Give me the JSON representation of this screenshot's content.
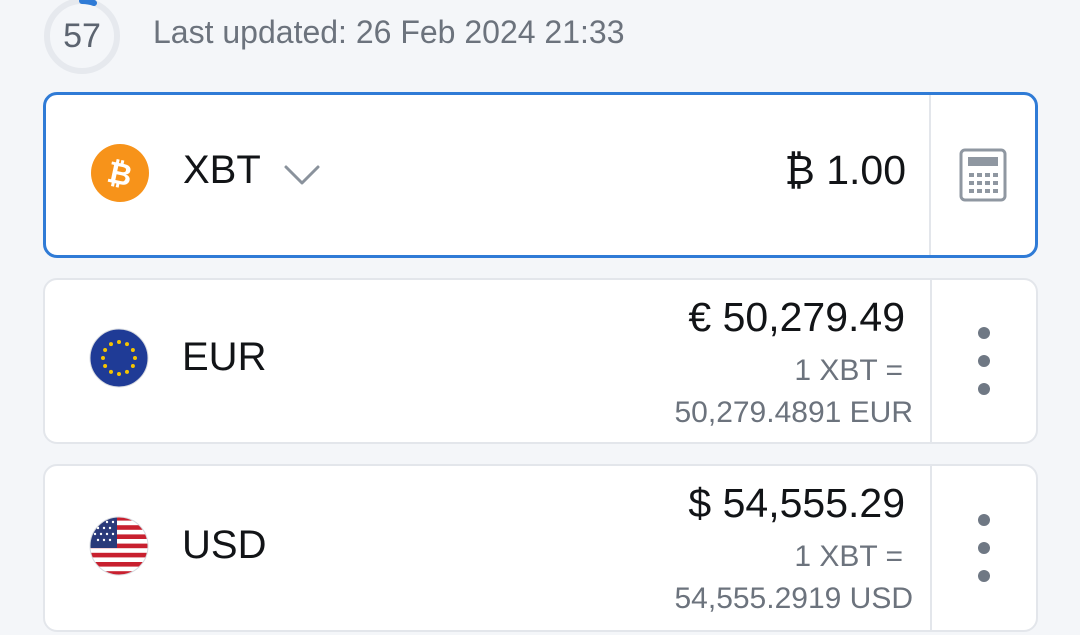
{
  "header": {
    "countdown": "57",
    "last_updated": "Last updated: 26 Feb 2024 21:33"
  },
  "base": {
    "code": "XBT",
    "amount": "₿ 1.00",
    "icon": "bitcoin-icon",
    "accent": "#2f7bd6"
  },
  "conversions": [
    {
      "code": "EUR",
      "amount": "€ 50,279.49",
      "rate_line1": "1 XBT =",
      "rate_line2": "50,279.4891 EUR",
      "icon": "eu-flag-icon"
    },
    {
      "code": "USD",
      "amount": "$ 54,555.29",
      "rate_line1": "1 XBT =",
      "rate_line2": "54,555.2919 USD",
      "icon": "us-flag-icon"
    }
  ]
}
